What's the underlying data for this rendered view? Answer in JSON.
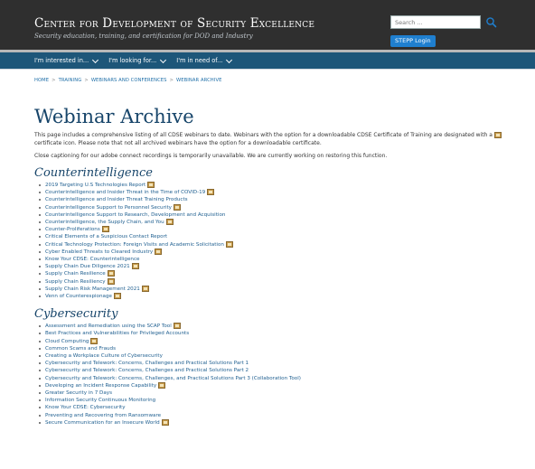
{
  "header": {
    "site_title": "Center for Development of Security Excellence",
    "site_subtitle": "Security education, training, and certification for DOD and Industry",
    "search_placeholder": "Search ...",
    "stepp_label": "STEPP Login"
  },
  "nav": {
    "items": [
      {
        "label": "I'm interested in..."
      },
      {
        "label": "I'm looking for..."
      },
      {
        "label": "I'm in need of..."
      }
    ]
  },
  "breadcrumb": [
    "Home",
    "Training",
    "Webinars and Conferences",
    "Webinar Archive"
  ],
  "page": {
    "title": "Webinar Archive",
    "intro_1": "This page includes a comprehensive listing of all CDSE webinars to date. Webinars with the option for a downloadable CDSE Certificate of Training are designated with a",
    "intro_2": "certificate icon. Please note that not all archived webinars have the option for a downloadable certificate.",
    "notice": "Close captioning for our adobe connect recordings is temporarily unavailable. We are currently working on restoring this function."
  },
  "sections": [
    {
      "title": "Counterintelligence",
      "items": [
        {
          "label": "2019 Targeting U.S Technologies Report",
          "cert": true
        },
        {
          "label": "Counterintelligence and Insider Threat in the Time of COVID-19",
          "cert": true
        },
        {
          "label": "Counterintelligence and Insider Threat Training Products",
          "cert": false
        },
        {
          "label": "Counterintelligence Support to Personnel Security",
          "cert": true
        },
        {
          "label": "Counterintelligence Support to Research, Development and Acquisition",
          "cert": false
        },
        {
          "label": "Counterintelligence, the Supply Chain, and You",
          "cert": true
        },
        {
          "label": "Counter-Proliferations",
          "cert": true
        },
        {
          "label": "Critical Elements of a Suspicious Contact Report",
          "cert": false
        },
        {
          "label": "Critical Technology Protection: Foreign Visits and Academic Solicitation",
          "cert": true
        },
        {
          "label": "Cyber Enabled Threats to Cleared Industry",
          "cert": true
        },
        {
          "label": "Know Your CDSE: Counterintelligence",
          "cert": false
        },
        {
          "label": "Supply Chain Due Diligence 2021",
          "cert": true
        },
        {
          "label": "Supply Chain Resilience",
          "cert": true
        },
        {
          "label": "Supply Chain Resiliency",
          "cert": true
        },
        {
          "label": "Supply Chain Risk Management 2021",
          "cert": true
        },
        {
          "label": "Venn of Counterespionage",
          "cert": true
        }
      ]
    },
    {
      "title": "Cybersecurity",
      "items": [
        {
          "label": "Assessment and Remediation using the SCAP Tool",
          "cert": true
        },
        {
          "label": "Best Practices and Vulnerabilities for Privileged Accounts",
          "cert": false
        },
        {
          "label": "Cloud Computing",
          "cert": true
        },
        {
          "label": "Common Scams and Frauds",
          "cert": false
        },
        {
          "label": "Creating a Workplace Culture of Cybersecurity",
          "cert": false
        },
        {
          "label": "Cybersecurity and Telework: Concerns, Challenges and Practical Solutions Part 1",
          "cert": false
        },
        {
          "label": "Cybersecurity and Telework: Concerns, Challenges and Practical Solutions Part 2",
          "cert": false
        },
        {
          "label": "Cybersecurity and Telework: Concerns, Challenges, and Practical Solutions Part 3 (Collaboration Tool)",
          "cert": false
        },
        {
          "label": "Developing an Incident Response Capability",
          "cert": true
        },
        {
          "label": "Greater Security in 7 Days",
          "cert": false
        },
        {
          "label": "Information Security Continuous Monitoring",
          "cert": false
        },
        {
          "label": "Know Your CDSE: Cybersecurity",
          "cert": false
        },
        {
          "label": "Preventing and Recovering from Ransomware",
          "cert": false
        },
        {
          "label": "Secure Communication for an Insecure World",
          "cert": true
        }
      ]
    }
  ]
}
